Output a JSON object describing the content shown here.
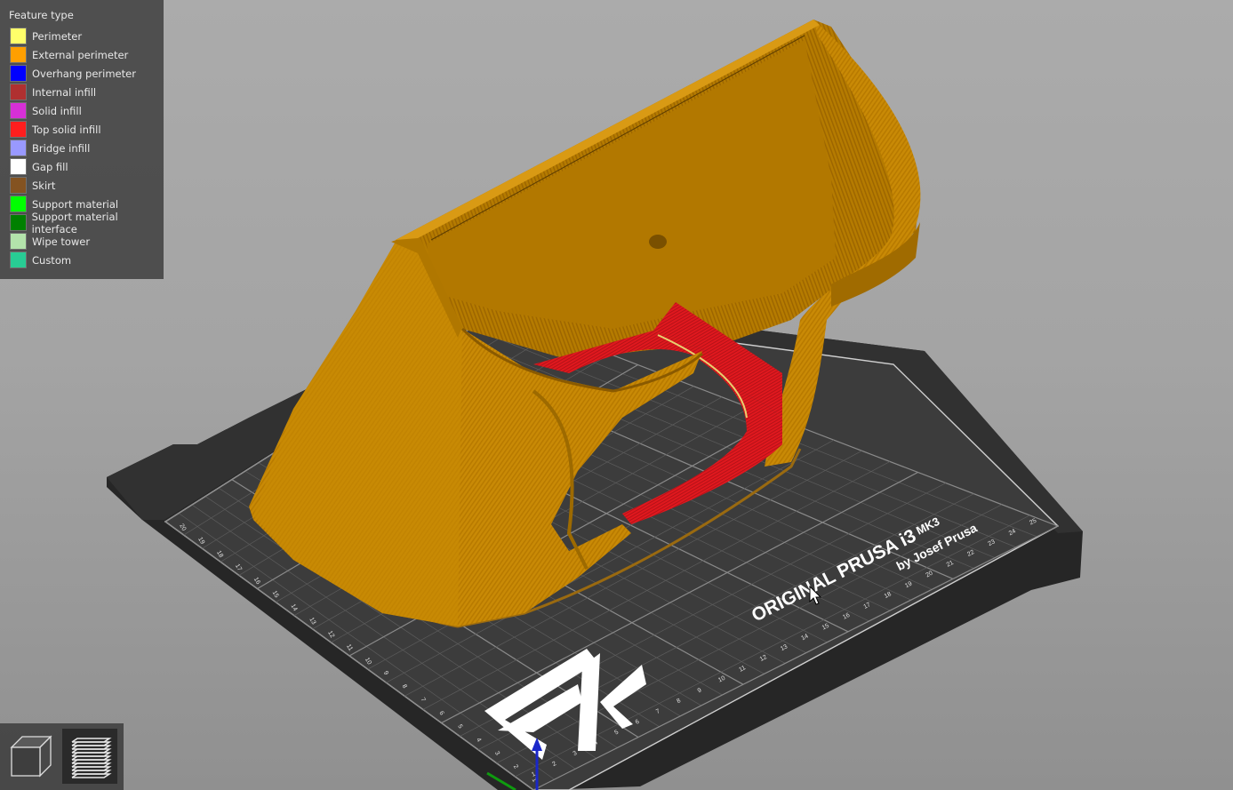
{
  "legend": {
    "title": "Feature type",
    "items": [
      {
        "label": "Perimeter",
        "color": "#ffff6a"
      },
      {
        "label": "External perimeter",
        "color": "#ff9f00"
      },
      {
        "label": "Overhang perimeter",
        "color": "#0000ff"
      },
      {
        "label": "Internal infill",
        "color": "#b03030"
      },
      {
        "label": "Solid infill",
        "color": "#d62fd6"
      },
      {
        "label": "Top solid infill",
        "color": "#ff1e1e"
      },
      {
        "label": "Bridge infill",
        "color": "#9999ff"
      },
      {
        "label": "Gap fill",
        "color": "#ffffff"
      },
      {
        "label": "Skirt",
        "color": "#845321"
      },
      {
        "label": "Support material",
        "color": "#00ff00"
      },
      {
        "label": "Support material interface",
        "color": "#008000"
      },
      {
        "label": "Wipe tower",
        "color": "#b3e3ab"
      },
      {
        "label": "Custom",
        "color": "#28cc94"
      }
    ]
  },
  "bed": {
    "brand_line1": "ORIGINAL PRUSA i3",
    "model": "MK3",
    "brand_line2": "by Josef Prusa",
    "logo_text": "SK",
    "x_ticks": [
      "1",
      "2",
      "3",
      "4",
      "5",
      "6",
      "7",
      "8",
      "9",
      "10",
      "11",
      "12",
      "13",
      "14",
      "15",
      "16",
      "17",
      "18",
      "19",
      "20",
      "21",
      "22",
      "23",
      "24",
      "25"
    ],
    "y_ticks": [
      "1",
      "2",
      "3",
      "4",
      "5",
      "6",
      "7",
      "8",
      "9",
      "10",
      "11",
      "12",
      "13",
      "14",
      "15",
      "16",
      "17",
      "18",
      "19",
      "20"
    ],
    "surface_color": "#3c3c3c",
    "frame_color": "#262626"
  },
  "model": {
    "wall_color": "#c98a06",
    "wall_dark": "#a86f00",
    "top_infill_color": "#e0181e"
  },
  "toolbar": {
    "buttons": [
      {
        "name": "3d-view",
        "active": false
      },
      {
        "name": "layers-view",
        "active": true
      }
    ]
  }
}
